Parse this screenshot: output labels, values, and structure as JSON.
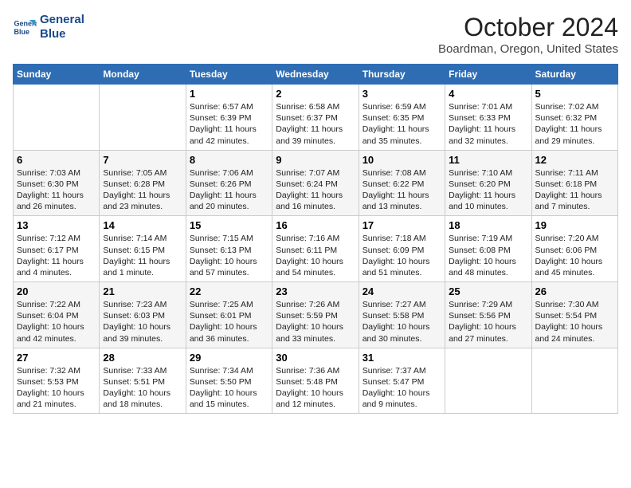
{
  "header": {
    "logo_line1": "General",
    "logo_line2": "Blue",
    "month": "October 2024",
    "location": "Boardman, Oregon, United States"
  },
  "columns": [
    "Sunday",
    "Monday",
    "Tuesday",
    "Wednesday",
    "Thursday",
    "Friday",
    "Saturday"
  ],
  "weeks": [
    [
      {
        "day": "",
        "info": ""
      },
      {
        "day": "",
        "info": ""
      },
      {
        "day": "1",
        "info": "Sunrise: 6:57 AM\nSunset: 6:39 PM\nDaylight: 11 hours and 42 minutes."
      },
      {
        "day": "2",
        "info": "Sunrise: 6:58 AM\nSunset: 6:37 PM\nDaylight: 11 hours and 39 minutes."
      },
      {
        "day": "3",
        "info": "Sunrise: 6:59 AM\nSunset: 6:35 PM\nDaylight: 11 hours and 35 minutes."
      },
      {
        "day": "4",
        "info": "Sunrise: 7:01 AM\nSunset: 6:33 PM\nDaylight: 11 hours and 32 minutes."
      },
      {
        "day": "5",
        "info": "Sunrise: 7:02 AM\nSunset: 6:32 PM\nDaylight: 11 hours and 29 minutes."
      }
    ],
    [
      {
        "day": "6",
        "info": "Sunrise: 7:03 AM\nSunset: 6:30 PM\nDaylight: 11 hours and 26 minutes."
      },
      {
        "day": "7",
        "info": "Sunrise: 7:05 AM\nSunset: 6:28 PM\nDaylight: 11 hours and 23 minutes."
      },
      {
        "day": "8",
        "info": "Sunrise: 7:06 AM\nSunset: 6:26 PM\nDaylight: 11 hours and 20 minutes."
      },
      {
        "day": "9",
        "info": "Sunrise: 7:07 AM\nSunset: 6:24 PM\nDaylight: 11 hours and 16 minutes."
      },
      {
        "day": "10",
        "info": "Sunrise: 7:08 AM\nSunset: 6:22 PM\nDaylight: 11 hours and 13 minutes."
      },
      {
        "day": "11",
        "info": "Sunrise: 7:10 AM\nSunset: 6:20 PM\nDaylight: 11 hours and 10 minutes."
      },
      {
        "day": "12",
        "info": "Sunrise: 7:11 AM\nSunset: 6:18 PM\nDaylight: 11 hours and 7 minutes."
      }
    ],
    [
      {
        "day": "13",
        "info": "Sunrise: 7:12 AM\nSunset: 6:17 PM\nDaylight: 11 hours and 4 minutes."
      },
      {
        "day": "14",
        "info": "Sunrise: 7:14 AM\nSunset: 6:15 PM\nDaylight: 11 hours and 1 minute."
      },
      {
        "day": "15",
        "info": "Sunrise: 7:15 AM\nSunset: 6:13 PM\nDaylight: 10 hours and 57 minutes."
      },
      {
        "day": "16",
        "info": "Sunrise: 7:16 AM\nSunset: 6:11 PM\nDaylight: 10 hours and 54 minutes."
      },
      {
        "day": "17",
        "info": "Sunrise: 7:18 AM\nSunset: 6:09 PM\nDaylight: 10 hours and 51 minutes."
      },
      {
        "day": "18",
        "info": "Sunrise: 7:19 AM\nSunset: 6:08 PM\nDaylight: 10 hours and 48 minutes."
      },
      {
        "day": "19",
        "info": "Sunrise: 7:20 AM\nSunset: 6:06 PM\nDaylight: 10 hours and 45 minutes."
      }
    ],
    [
      {
        "day": "20",
        "info": "Sunrise: 7:22 AM\nSunset: 6:04 PM\nDaylight: 10 hours and 42 minutes."
      },
      {
        "day": "21",
        "info": "Sunrise: 7:23 AM\nSunset: 6:03 PM\nDaylight: 10 hours and 39 minutes."
      },
      {
        "day": "22",
        "info": "Sunrise: 7:25 AM\nSunset: 6:01 PM\nDaylight: 10 hours and 36 minutes."
      },
      {
        "day": "23",
        "info": "Sunrise: 7:26 AM\nSunset: 5:59 PM\nDaylight: 10 hours and 33 minutes."
      },
      {
        "day": "24",
        "info": "Sunrise: 7:27 AM\nSunset: 5:58 PM\nDaylight: 10 hours and 30 minutes."
      },
      {
        "day": "25",
        "info": "Sunrise: 7:29 AM\nSunset: 5:56 PM\nDaylight: 10 hours and 27 minutes."
      },
      {
        "day": "26",
        "info": "Sunrise: 7:30 AM\nSunset: 5:54 PM\nDaylight: 10 hours and 24 minutes."
      }
    ],
    [
      {
        "day": "27",
        "info": "Sunrise: 7:32 AM\nSunset: 5:53 PM\nDaylight: 10 hours and 21 minutes."
      },
      {
        "day": "28",
        "info": "Sunrise: 7:33 AM\nSunset: 5:51 PM\nDaylight: 10 hours and 18 minutes."
      },
      {
        "day": "29",
        "info": "Sunrise: 7:34 AM\nSunset: 5:50 PM\nDaylight: 10 hours and 15 minutes."
      },
      {
        "day": "30",
        "info": "Sunrise: 7:36 AM\nSunset: 5:48 PM\nDaylight: 10 hours and 12 minutes."
      },
      {
        "day": "31",
        "info": "Sunrise: 7:37 AM\nSunset: 5:47 PM\nDaylight: 10 hours and 9 minutes."
      },
      {
        "day": "",
        "info": ""
      },
      {
        "day": "",
        "info": ""
      }
    ]
  ]
}
